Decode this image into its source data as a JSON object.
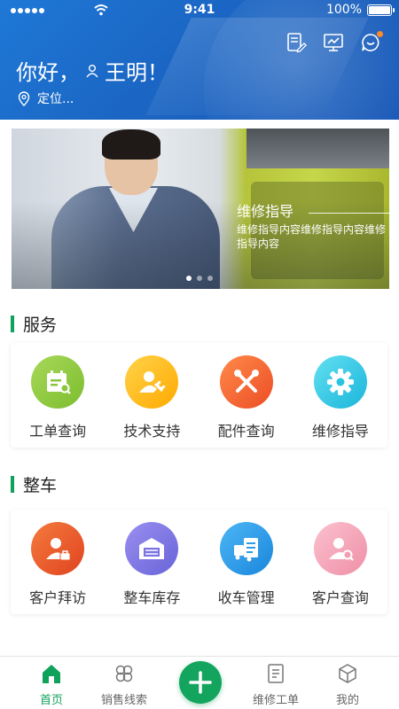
{
  "status_bar": {
    "time": "9:41",
    "battery": "100%"
  },
  "header": {
    "greeting_prefix": "你好，",
    "user_name": "王明！",
    "location": "定位...",
    "icons": [
      "edit-doc-icon",
      "presentation-icon",
      "message-icon"
    ]
  },
  "banner": {
    "title": "维修指导",
    "subtitle": "维修指导内容维修指导内容维修指导内容",
    "active_slide": 1,
    "slide_count": 3
  },
  "services": {
    "title": "服务",
    "items": [
      {
        "label": "工单查询",
        "icon": "calendar-search-icon",
        "color": "#8cc63f"
      },
      {
        "label": "技术支持",
        "icon": "user-wrench-icon",
        "color": "#ffb400"
      },
      {
        "label": "配件查询",
        "icon": "tools-icon",
        "color": "#f0652f"
      },
      {
        "label": "维修指导",
        "icon": "gear-icon",
        "color": "#28c4e3"
      }
    ]
  },
  "vehicles": {
    "title": "整车",
    "items": [
      {
        "label": "客户拜访",
        "icon": "user-briefcase-icon",
        "color": "#ee5b2e"
      },
      {
        "label": "整车库存",
        "icon": "warehouse-icon",
        "color": "#7b73e3"
      },
      {
        "label": "收车管理",
        "icon": "truck-clipboard-icon",
        "color": "#2d9be8"
      },
      {
        "label": "客户查询",
        "icon": "user-search-icon",
        "color": "#f59db3"
      }
    ]
  },
  "tabbar": {
    "accent": "#10a15a",
    "tabs": [
      {
        "label": "首页",
        "icon": "home-icon",
        "active": true
      },
      {
        "label": "销售线索",
        "icon": "clover-icon",
        "active": false
      },
      {
        "label": "维修工单",
        "icon": "form-icon",
        "active": false
      },
      {
        "label": "我的",
        "icon": "box-icon",
        "active": false
      }
    ],
    "fab_icon": "plus-icon"
  }
}
